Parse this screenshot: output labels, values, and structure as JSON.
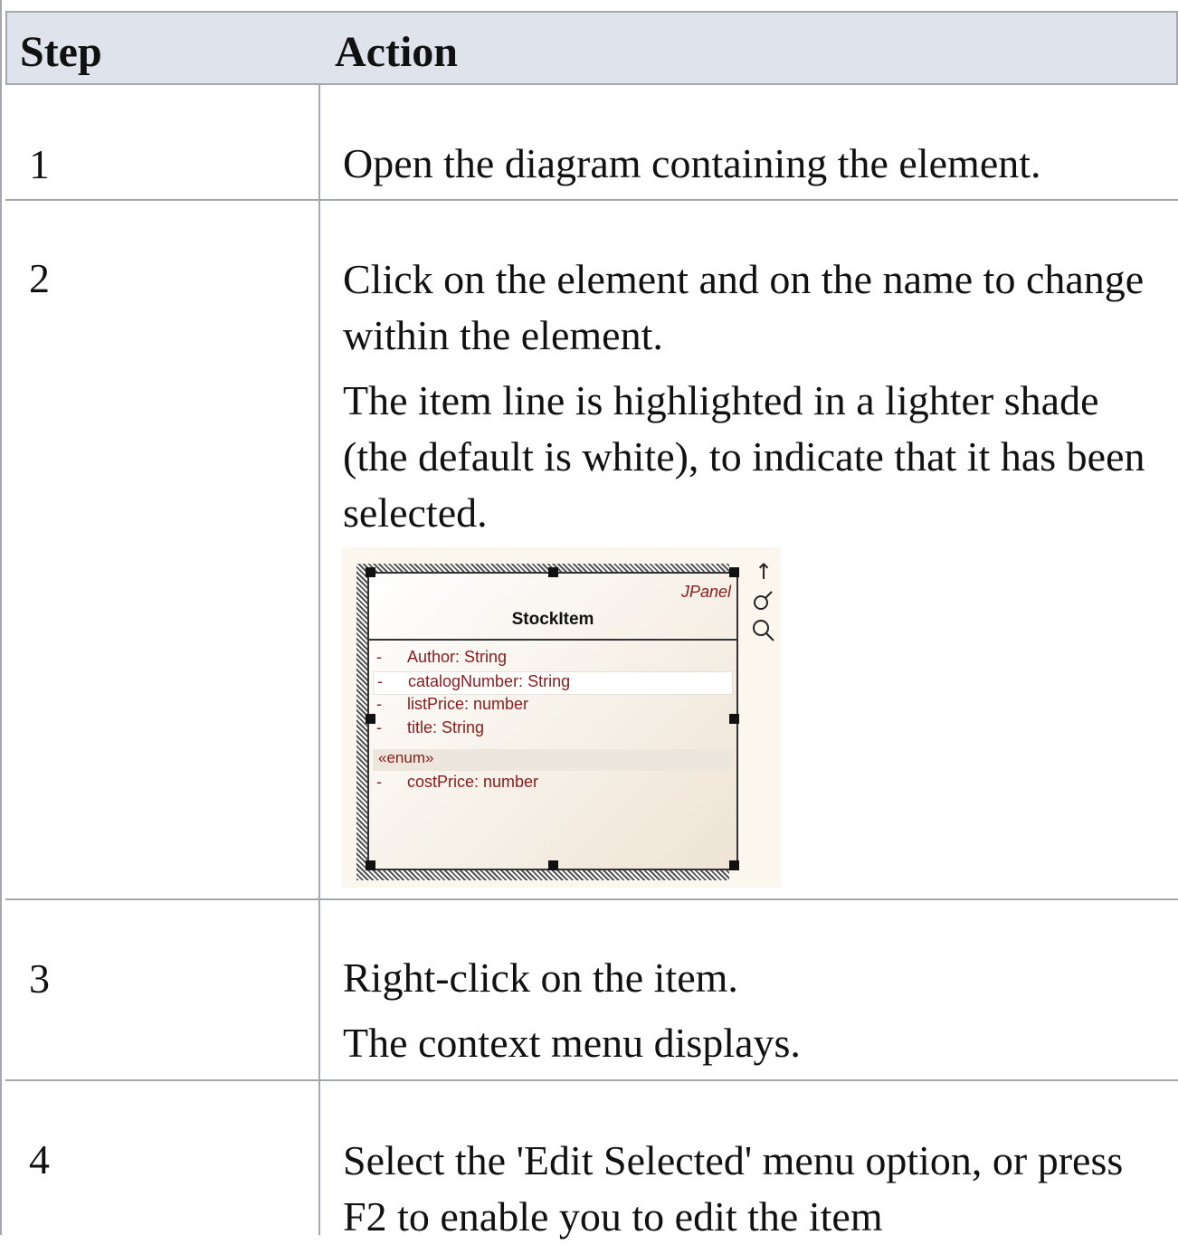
{
  "table": {
    "header": {
      "step": "Step",
      "action": "Action"
    },
    "rows": [
      {
        "step": "1",
        "paragraphs": [
          "Open the diagram containing the element."
        ]
      },
      {
        "step": "2",
        "paragraphs": [
          "Click on the element and on the name to change within the element.",
          "The item line is highlighted in a lighter shade (the default is white), to indicate that it has been selected."
        ]
      },
      {
        "step": "3",
        "paragraphs": [
          "Right-click on the item.",
          "The context menu displays."
        ]
      },
      {
        "step": "4",
        "paragraphs": [
          "Select the 'Edit Selected' menu option, or press F2 to enable you to edit the item"
        ]
      }
    ]
  },
  "figure": {
    "stereotype": "JPanel",
    "class_name": "StockItem",
    "attributes": [
      {
        "vis": "-",
        "text": "Author:  String",
        "selected": false
      },
      {
        "vis": "-",
        "text": "catalogNumber:  String",
        "selected": true
      },
      {
        "vis": "-",
        "text": "listPrice:  number",
        "selected": false
      },
      {
        "vis": "-",
        "text": "title:  String",
        "selected": false
      }
    ],
    "enum_label": "«enum»",
    "enum_attribute": {
      "vis": "-",
      "text": "costPrice:  number"
    },
    "toolbar_icons": [
      "arrow-up-icon",
      "link-icon",
      "magnifier-icon"
    ]
  }
}
